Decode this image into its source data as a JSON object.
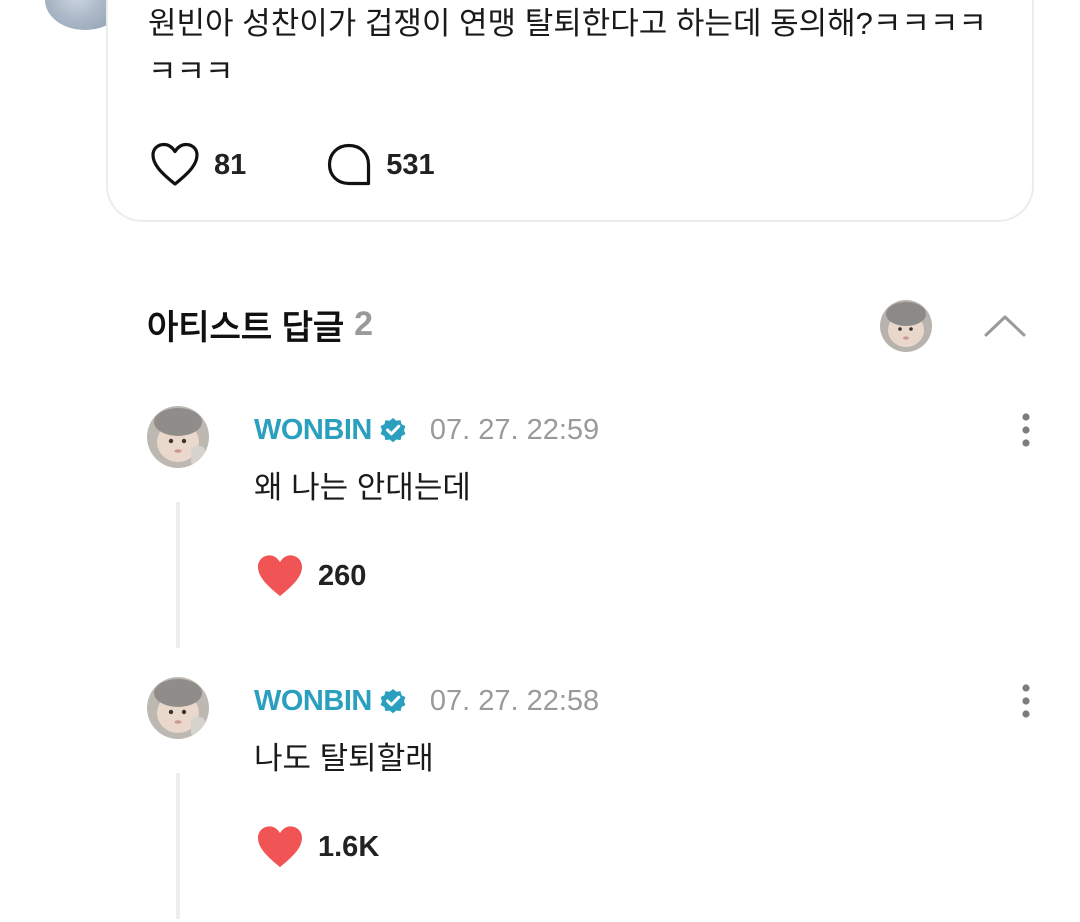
{
  "post": {
    "text": "원빈아 성찬이가 겁쟁이 연맹 탈퇴한다고 하는데 동의해?ㅋㅋㅋㅋㅋㅋㅋ",
    "like_count": "81",
    "comment_count": "531"
  },
  "artist_replies": {
    "title": "아티스트 답글",
    "count": "2",
    "replies": [
      {
        "author": "WONBIN",
        "timestamp": "07. 27. 22:59",
        "text": "왜 나는 안대는데",
        "like_count": "260"
      },
      {
        "author": "WONBIN",
        "timestamp": "07. 27. 22:58",
        "text": "나도 탈퇴할래",
        "like_count": "1.6K"
      }
    ]
  },
  "colors": {
    "accent": "#2a9fbe",
    "heart": "#f05454",
    "muted": "#9a9a9a",
    "thread_line": "#ededed"
  },
  "icons": {
    "like": "heart-outline-icon",
    "comment": "speech-bubble-icon",
    "verified": "verified-badge-icon",
    "collapse": "chevron-up-icon",
    "more": "more-vertical-icon",
    "liked": "heart-filled-icon"
  }
}
